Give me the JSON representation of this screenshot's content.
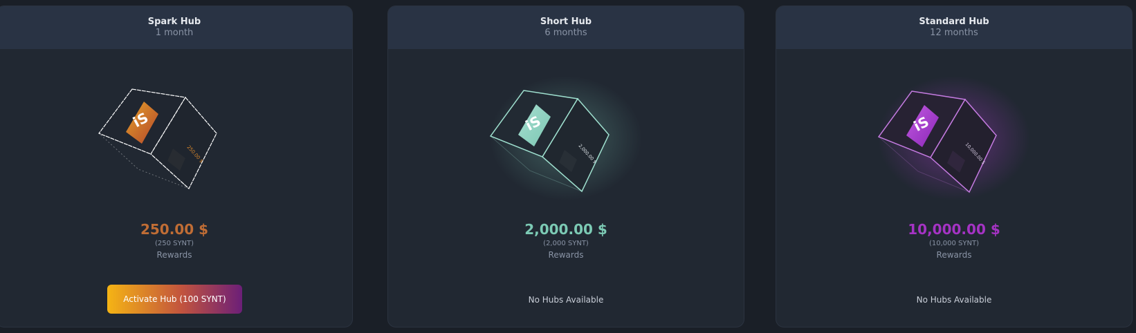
{
  "hubs": [
    {
      "title": "Spark Hub",
      "duration": "1 month",
      "price_amount": "250.00",
      "price_currency": "$",
      "synt": "(250 SYNT)",
      "rewards": "Rewards",
      "cube_side_label": "250.00 $",
      "action": "Activate Hub (100 SYNT)",
      "accent_color": "#c06d35",
      "icon": "hub-logo-icon"
    },
    {
      "title": "Short Hub",
      "duration": "6 months",
      "price_amount": "2,000.00",
      "price_currency": "$",
      "synt": "(2,000 SYNT)",
      "rewards": "Rewards",
      "cube_side_label": "2,000.00 $",
      "status": "No Hubs Available",
      "accent_color": "#7ccab4",
      "icon": "hub-logo-icon"
    },
    {
      "title": "Standard Hub",
      "duration": "12 months",
      "price_amount": "10,000.00",
      "price_currency": "$",
      "synt": "(10,000 SYNT)",
      "rewards": "Rewards",
      "cube_side_label": "10,000.00 $",
      "status": "No Hubs Available",
      "accent_color": "#a533c4",
      "icon": "hub-logo-icon"
    }
  ]
}
